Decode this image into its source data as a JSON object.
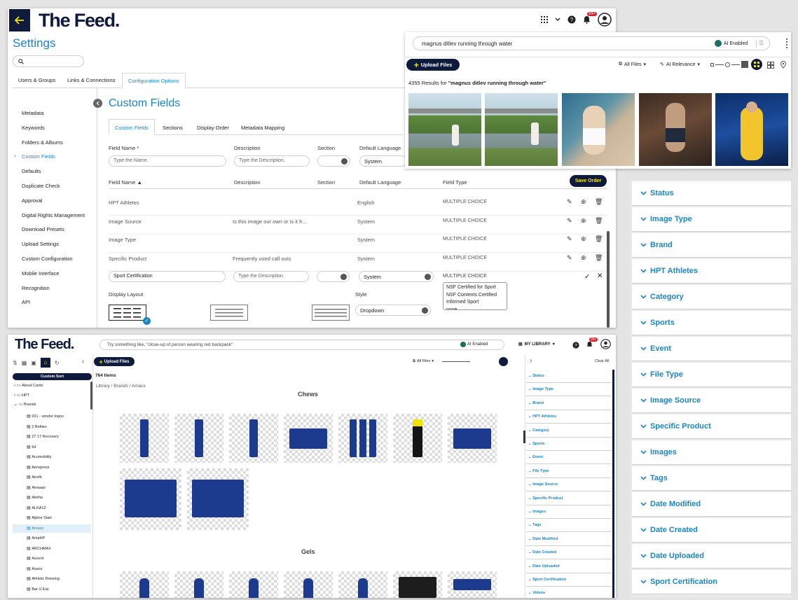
{
  "settings": {
    "logo": "The Feed.",
    "notif_count": "99+",
    "title": "Settings",
    "tabs": [
      "Users & Groups",
      "Links & Connections",
      "Configuration Options"
    ],
    "sidebar": [
      "Metadata",
      "Keywords",
      "Folders & Albums",
      "Custom Fields",
      "Defaults",
      "Duplicate Check",
      "Approval",
      "Digital Rights Management",
      "Download Presets",
      "Upload Settings",
      "Custom Configuration",
      "Mobile Interface",
      "Recognition",
      "API"
    ],
    "section_title": "Custom Fields",
    "subtabs": [
      "Custom Fields",
      "Sections",
      "Display Order",
      "Metadata Mapping"
    ],
    "new_field": {
      "field_name_label": "Field Name *",
      "description_label": "Description",
      "section_label": "Section",
      "language_label": "Default Language",
      "name_placeholder": "Type the Name.",
      "desc_placeholder": "Type the Description.",
      "language_value": "System"
    },
    "table_headers": [
      "Field Name",
      "Description",
      "Section",
      "Default Language",
      "Field Type"
    ],
    "save_order": "Save Order",
    "rows": [
      {
        "name": "HPT Athletes",
        "desc": "",
        "lang": "English",
        "type": "MULTIPLE CHOICE"
      },
      {
        "name": "Image Source",
        "desc": "Is this image our own or is it fr...",
        "lang": "System",
        "type": "MULTIPLE CHOICE"
      },
      {
        "name": "Image Type",
        "desc": "",
        "lang": "System",
        "type": "MULTIPLE CHOICE"
      },
      {
        "name": "Specific Product",
        "desc": "Frequently used call outs",
        "lang": "System",
        "type": "MULTIPLE CHOICE"
      }
    ],
    "edit_row": {
      "name": "Sport Certification",
      "desc_placeholder": "Type the Description.",
      "lang": "System",
      "type": "MULTIPLE CHOICE",
      "choices": [
        "NSF Certified for Sport",
        "NSF Contents Certified",
        "Informed Sport",
        "none"
      ],
      "display_layout_label": "Display Layout",
      "style_label": "Style",
      "style_value": "Dropdown"
    }
  },
  "search_panel": {
    "query": "magnus ditlev running through water",
    "ai_label": "AI Enabled",
    "upload": "Upload Files",
    "all_files": "All Files",
    "ai_relevance": "AI Relevance",
    "results_count": "4355",
    "results_text": "Results for",
    "results_query": "\"magnus ditlev running through water\""
  },
  "library": {
    "logo": "The Feed.",
    "search_placeholder": "Try something like, \"close-up of person wearing red backpack\"",
    "ai_label": "AI Enabled",
    "my_library": "MY LIBRARY",
    "notif_count": "99+",
    "custom_sort": "Custom Sort",
    "upload": "Upload Files",
    "all_files": "All Files",
    "items_count": "764",
    "items_label": "Items",
    "breadcrumb": [
      "Library",
      "Brands",
      "Amacx"
    ],
    "tree_top": [
      "About Canto",
      "HPT",
      "Brands"
    ],
    "tree_brands": [
      "001 - vendor logos",
      "2 Betties",
      "27 17 Recovery",
      "6d",
      "Acumobility",
      "Aeropress",
      "Airofit",
      "Airwaav",
      "Aletha",
      "ALKA12",
      "Alpine Start",
      "Amacx",
      "AmpHP",
      "ARCHMAX",
      "Ascent",
      "Assos",
      "Athletic Brewing",
      "Bar U Eat"
    ],
    "group1": "Chews",
    "group2": "Gels",
    "clear_all": "Clear All",
    "filters": [
      "Status",
      "Image Type",
      "Brand",
      "HPT Athletes",
      "Category",
      "Sports",
      "Event",
      "File Type",
      "Image Source",
      "Specific Product",
      "Images",
      "Tags",
      "Date Modified",
      "Date Created",
      "Date Uploaded",
      "Sport Certification",
      "Videos"
    ]
  },
  "facets": [
    "Status",
    "Image Type",
    "Brand",
    "HPT Athletes",
    "Category",
    "Sports",
    "Event",
    "File Type",
    "Image Source",
    "Specific Product",
    "Images",
    "Tags",
    "Date Modified",
    "Date Created",
    "Date Uploaded",
    "Sport Certification"
  ]
}
